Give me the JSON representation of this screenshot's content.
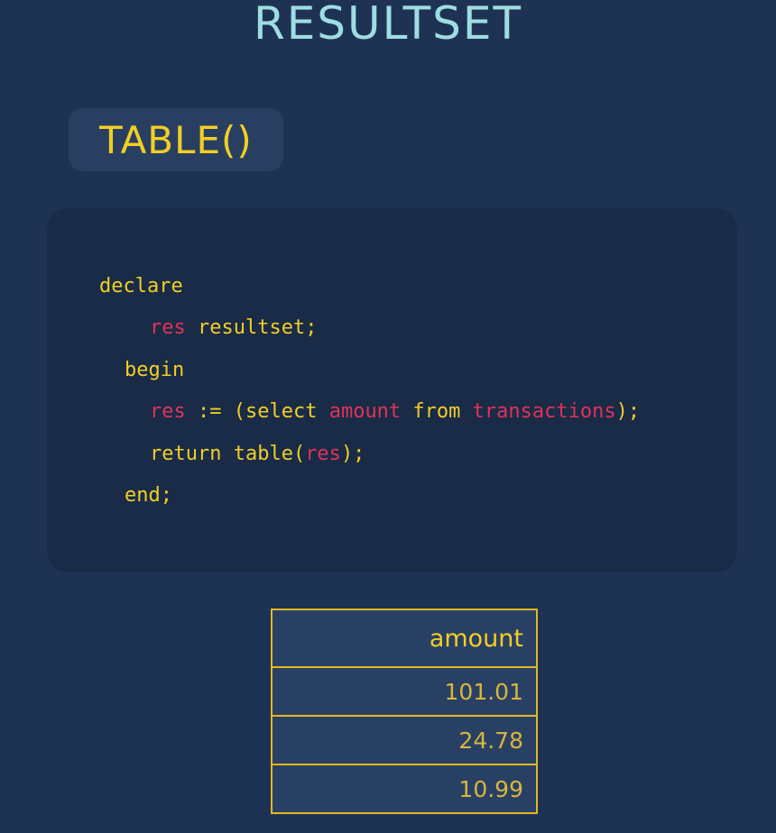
{
  "page": {
    "title": "RESULTSET",
    "badge": "TABLE()"
  },
  "code": {
    "line1": {
      "kw": "declare"
    },
    "line2": {
      "id": "res",
      "rest": " resultset;"
    },
    "line3": {
      "kw": "begin"
    },
    "line4": {
      "id1": "res",
      "kw1": " := (select ",
      "id2": "amount",
      "kw2": " from ",
      "id3": "transactions",
      "kw3": ");"
    },
    "line5": {
      "kw1": "return table(",
      "id": "res",
      "kw2": ");"
    },
    "line6": {
      "kw": "end;"
    }
  },
  "colors": {
    "background": "#1e3354",
    "code_background": "#192b47",
    "keyword": "#f2ce25",
    "identifier": "#e0325a",
    "title": "#9fdde0",
    "table_border": "#e3b91f"
  },
  "table": {
    "header": "amount",
    "rows": [
      "101.01",
      "24.78",
      "10.99"
    ]
  }
}
